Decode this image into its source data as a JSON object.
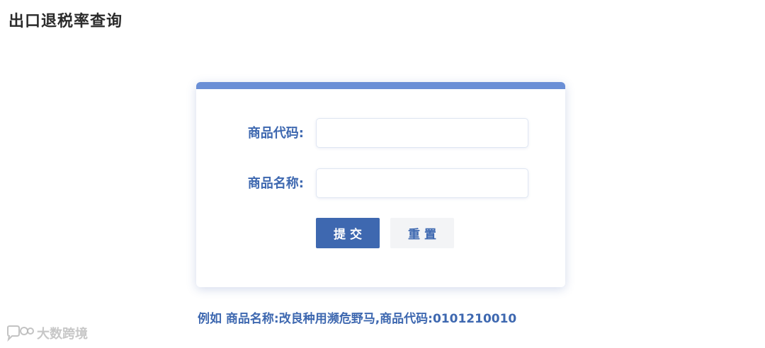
{
  "header": {
    "title": "出口退税率查询"
  },
  "form": {
    "code_label": "商品代码:",
    "code_value": "",
    "code_placeholder": "",
    "name_label": "商品名称:",
    "name_value": "",
    "name_placeholder": "",
    "submit_label": "提交",
    "reset_label": "重置"
  },
  "example": {
    "text": "例如 商品名称:改良种用濒危野马,商品代码:0101210010"
  },
  "watermark": {
    "text": "大数跨境",
    "icon": "chat-bubble-logo-icon"
  },
  "colors": {
    "accent": "#3e68b0",
    "topbar": "#6a8fd6",
    "reset_bg": "#f3f4f6"
  }
}
